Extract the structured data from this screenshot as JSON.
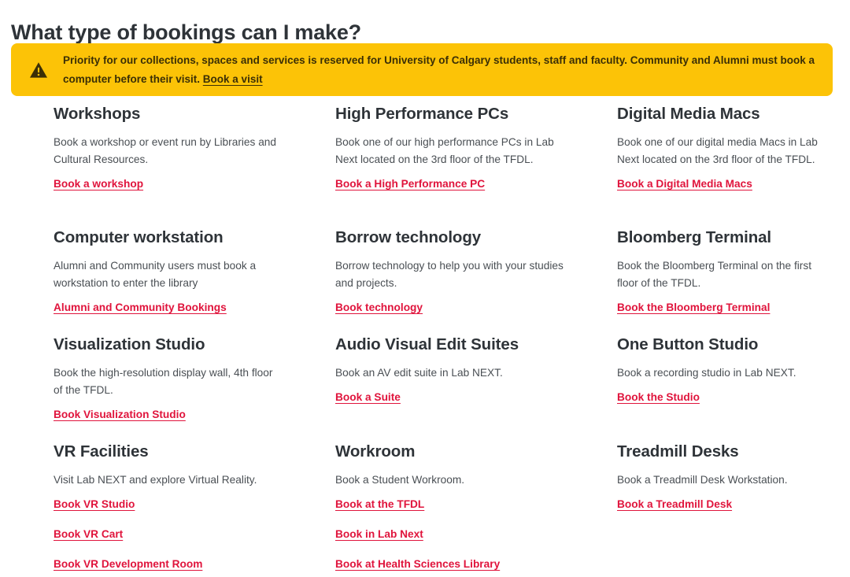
{
  "page": {
    "title": "What type of bookings can I make?"
  },
  "alert": {
    "icon": "warning-triangle-icon",
    "text_before_link": "Priority for our collections, spaces and services is reserved for University of Calgary students, staff and faculty. Community and Alumni must book a computer before their visit. ",
    "link_label": "Book a visit",
    "background_color": "#FCC307",
    "text_color": "#3B2F06"
  },
  "theme": {
    "link_color": "#E0143C",
    "heading_color": "#2E3338",
    "body_color": "#4A4F54"
  },
  "cards": [
    {
      "title": "Workshops",
      "description": "Book a workshop or event run by Libraries and Cultural Resources.",
      "links": [
        "Book a workshop"
      ]
    },
    {
      "title": "High Performance PCs",
      "description": "Book one of our high performance PCs in Lab Next located on the 3rd floor of the TFDL.",
      "links": [
        "Book a High Performance PC"
      ]
    },
    {
      "title": "Digital Media Macs",
      "description": "Book one of our digital media Macs in Lab Next located on the 3rd floor of the TFDL.",
      "links": [
        "Book a Digital Media Macs"
      ]
    },
    {
      "title": "Computer workstation",
      "description": "Alumni and Community users must book a workstation to enter the library",
      "links": [
        "Alumni and Community Bookings"
      ]
    },
    {
      "title": "Borrow technology",
      "description": "Borrow technology to help you with your studies and projects.",
      "links": [
        "Book technology"
      ]
    },
    {
      "title": "Bloomberg Terminal",
      "description": "Book the Bloomberg Terminal on the first floor of the TFDL.",
      "links": [
        "Book the Bloomberg Terminal"
      ]
    },
    {
      "title": "Visualization Studio",
      "description": "Book the high-resolution display wall, 4th floor of the TFDL.",
      "links": [
        "Book Visualization Studio"
      ]
    },
    {
      "title": "Audio Visual Edit Suites",
      "description": "Book an AV edit suite in Lab NEXT.",
      "links": [
        "Book a Suite"
      ]
    },
    {
      "title": "One Button Studio",
      "description": "Book a recording studio in Lab NEXT.",
      "links": [
        "Book the Studio"
      ]
    },
    {
      "title": "VR Facilities",
      "description": "Visit Lab NEXT and explore Virtual Reality.",
      "links": [
        "Book VR Studio",
        "Book VR Cart",
        "Book VR Development Room"
      ]
    },
    {
      "title": "Workroom",
      "description": "Book a Student Workroom.",
      "links": [
        "Book at the TFDL",
        "Book in Lab Next",
        "Book at Health Sciences Library"
      ]
    },
    {
      "title": "Treadmill Desks",
      "description": "Book a Treadmill Desk Workstation.",
      "links": [
        "Book a Treadmill Desk"
      ]
    }
  ]
}
